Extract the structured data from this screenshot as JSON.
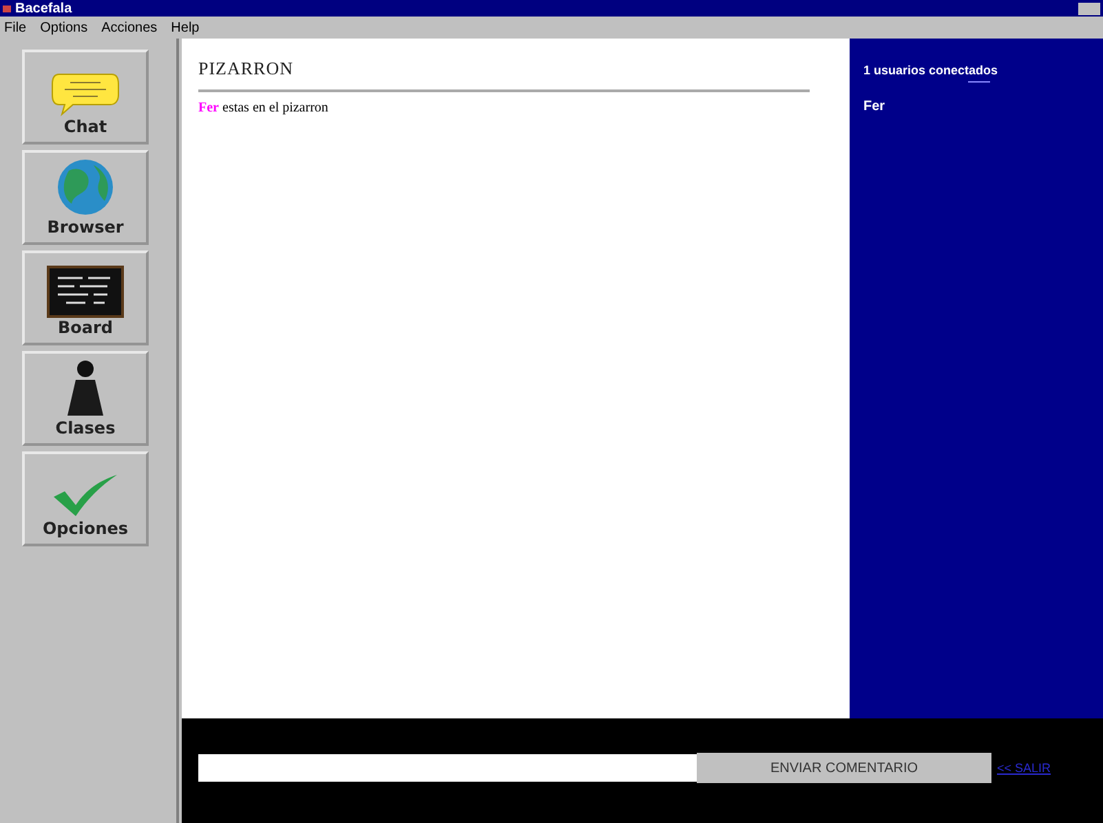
{
  "window": {
    "title": "Bacefala"
  },
  "menu": [
    "File",
    "Options",
    "Acciones",
    "Help"
  ],
  "sidebar": {
    "items": [
      {
        "label": "Chat",
        "kind": "chat"
      },
      {
        "label": "Browser",
        "kind": "browser"
      },
      {
        "label": "Board",
        "kind": "board"
      },
      {
        "label": "Clases",
        "kind": "clases"
      },
      {
        "label": "Opciones",
        "kind": "opciones"
      }
    ]
  },
  "board": {
    "title": "PIZARRON",
    "messages": [
      {
        "user": "Fer",
        "text": "estas en el pizarron",
        "color": "#ff00ff"
      }
    ]
  },
  "users": {
    "heading": "1 usuarios conectados",
    "list": [
      "Fer"
    ]
  },
  "footer": {
    "send_button": "ENVIAR COMENTARIO",
    "exit_link": "<< SALIR"
  }
}
